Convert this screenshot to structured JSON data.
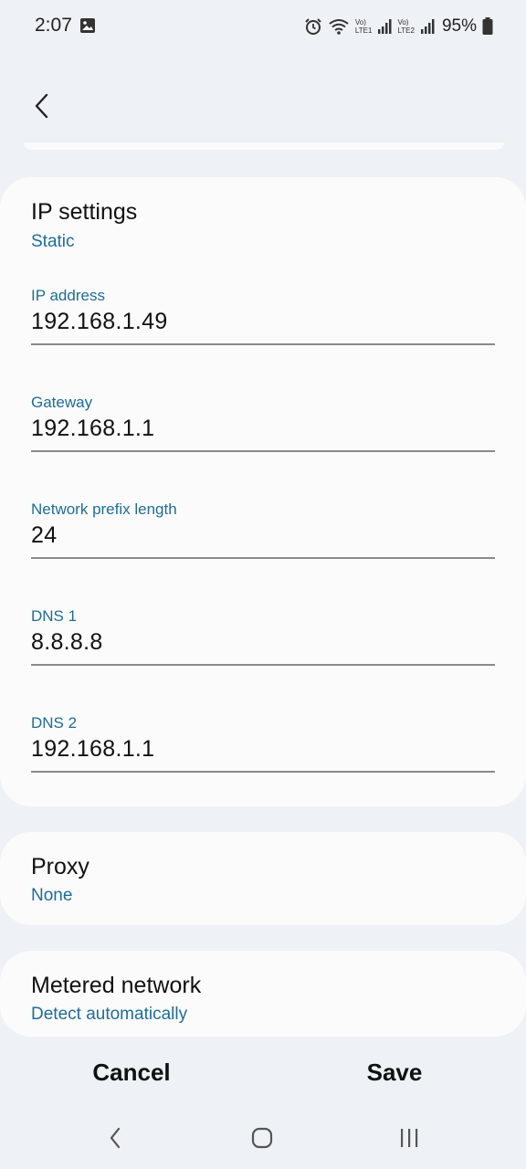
{
  "status_bar": {
    "time": "2:07",
    "lte1": [
      "Vo)",
      "LTE1"
    ],
    "lte2": [
      "Vo)",
      "LTE2"
    ],
    "battery": "95%"
  },
  "ip_settings": {
    "title": "IP settings",
    "mode": "Static",
    "fields": [
      {
        "label": "IP address",
        "value": "192.168.1.49"
      },
      {
        "label": "Gateway",
        "value": "192.168.1.1"
      },
      {
        "label": "Network prefix length",
        "value": "24"
      },
      {
        "label": "DNS 1",
        "value": "8.8.8.8"
      },
      {
        "label": "DNS 2",
        "value": "192.168.1.1"
      }
    ]
  },
  "proxy": {
    "title": "Proxy",
    "value": "None"
  },
  "metered": {
    "title": "Metered network",
    "value": "Detect automatically"
  },
  "actions": {
    "cancel": "Cancel",
    "save": "Save"
  },
  "colors": {
    "accent": "#1e6d96",
    "card": "#fbfbfb",
    "background": "#eef1f5"
  }
}
